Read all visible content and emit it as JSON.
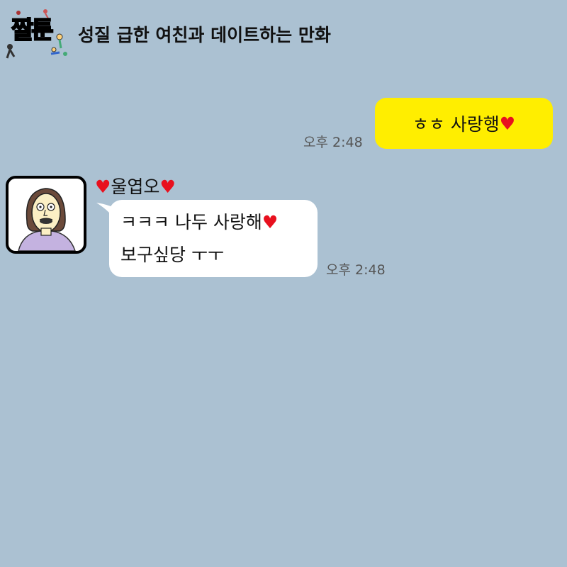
{
  "header": {
    "logo_text": "짤툰",
    "title": "성질 급한 여친과 데이트하는 만화"
  },
  "messages": {
    "outgoing": {
      "text": "ㅎㅎ 사랑행",
      "heart": "♥",
      "time": "오후 2:48"
    },
    "incoming": {
      "sender_name": "울엽오",
      "heart": "♥",
      "line1": "ㅋㅋㅋ 나두 사랑해",
      "line2": "보구싶당 ㅜㅜ",
      "time": "오후 2:48"
    }
  },
  "colors": {
    "background": "#abc1d2",
    "outgoing_bubble": "#ffee00",
    "incoming_bubble": "#ffffff",
    "heart": "#e8101e",
    "logo": "#ff1111"
  }
}
